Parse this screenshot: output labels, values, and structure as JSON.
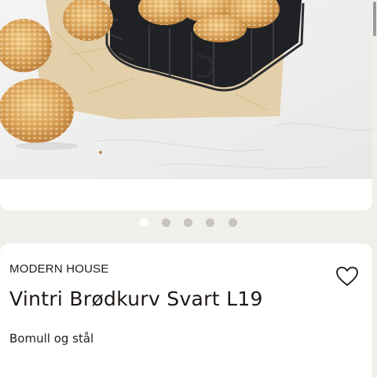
{
  "product": {
    "brand": "MODERN HOUSE",
    "title": "Vintri Brødkurv Svart L19",
    "description": "Bomull og stål"
  },
  "gallery": {
    "image_icon": "bread-basket-photo",
    "image_count": 5,
    "active_index": 0
  },
  "icons": {
    "favorite": "heart-outline-icon"
  },
  "colors": {
    "page_background": "#f1efea",
    "card_background": "#ffffff",
    "text": "#1e1815",
    "dot_inactive": "#c7c4bf",
    "dot_active": "#ffffff"
  }
}
